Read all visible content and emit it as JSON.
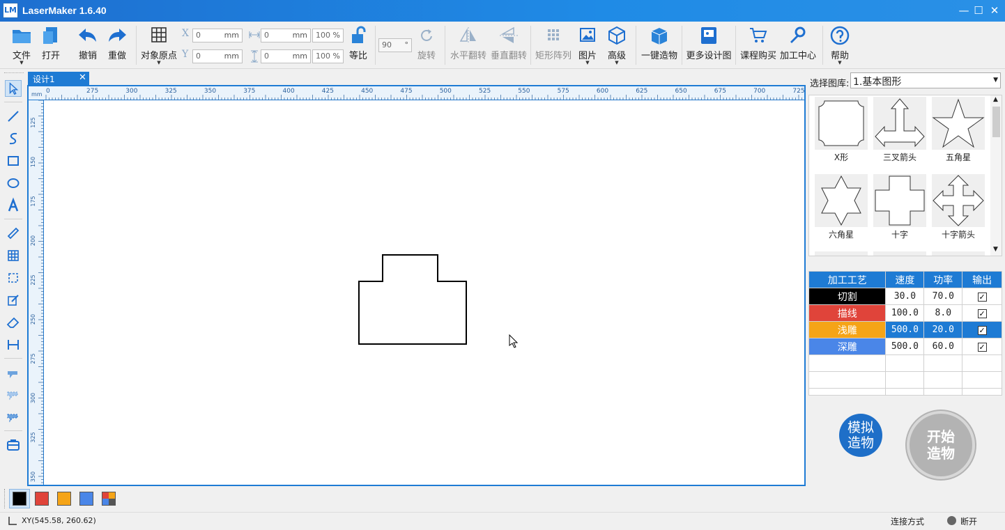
{
  "app": {
    "logo": "LM",
    "title": "LaserMaker 1.6.40"
  },
  "window": {
    "minimize": "—",
    "maximize": "☐",
    "close": "✕"
  },
  "toolbar": {
    "file": "文件",
    "open": "打开",
    "undo": "撤销",
    "redo": "重做",
    "origin": "对象原点",
    "x_label": "X",
    "y_label": "Y",
    "x_value": "0",
    "y_value": "0",
    "w_value": "0",
    "h_value": "0",
    "unit_mm": "mm",
    "w_pct": "100",
    "h_pct": "100",
    "pct": "%",
    "lock_ratio": "等比",
    "rotate_value": "90",
    "deg": "°",
    "rotate": "旋转",
    "hflip": "水平翻转",
    "vflip": "垂直翻转",
    "array": "矩形阵列",
    "image": "图片",
    "advanced": "高级",
    "one_click": "一键造物",
    "more_designs": "更多设计图",
    "courses": "课程购买",
    "process_center": "加工中心",
    "help": "帮助"
  },
  "tab": {
    "label": "设计1",
    "close": "✕"
  },
  "ruler": {
    "unit": "mm",
    "h_ticks": [
      "0",
      "275",
      "300",
      "325",
      "350",
      "375",
      "400",
      "425",
      "450",
      "475",
      "500",
      "525",
      "550",
      "575",
      "600",
      "625",
      "650",
      "675",
      "700",
      "725"
    ],
    "v_ticks": [
      "125",
      "150",
      "175",
      "200",
      "225",
      "250",
      "275",
      "300",
      "325",
      "350"
    ]
  },
  "library": {
    "label": "选择图库:",
    "selected": "1.基本图形",
    "shapes": [
      "X形",
      "三叉箭头",
      "五角星",
      "六角星",
      "十字",
      "十字箭头"
    ]
  },
  "process": {
    "headers": [
      "加工工艺",
      "速度",
      "功率",
      "输出"
    ],
    "rows": [
      {
        "name": "切割",
        "speed": "30.0",
        "power": "70.0",
        "color": "#000000"
      },
      {
        "name": "描线",
        "speed": "100.0",
        "power": "8.0",
        "color": "#e0443a"
      },
      {
        "name": "浅雕",
        "speed": "500.0",
        "power": "20.0",
        "color": "#f5a417"
      },
      {
        "name": "深雕",
        "speed": "500.0",
        "power": "60.0",
        "color": "#4a86e8"
      }
    ],
    "check": "✓"
  },
  "actions": {
    "simulate_1": "模拟",
    "simulate_2": "造物",
    "start_1": "开始",
    "start_2": "造物"
  },
  "colors": [
    "#000000",
    "#e0443a",
    "#f5a417",
    "#4a86e8"
  ],
  "status": {
    "coords": "XY(545.58, 260.62)",
    "connection_label": "连接方式",
    "connection_state": "断开"
  }
}
